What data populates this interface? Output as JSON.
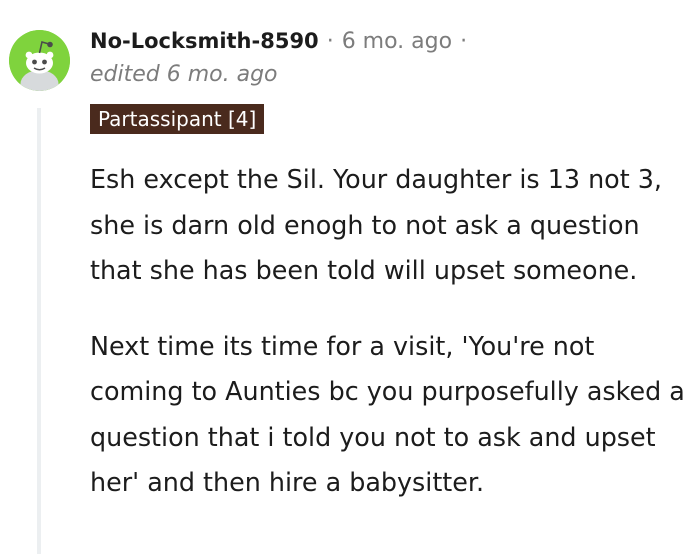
{
  "comment": {
    "username": "No-Locksmith-8590",
    "separator": "·",
    "time_ago": "6 mo. ago",
    "edited": "edited 6 mo. ago",
    "flair": "Partassipant [4]",
    "paragraphs": [
      "Esh except the Sil. Your daughter is 13 not 3, she is darn old enogh to not ask a question that she has been told will upset someone.",
      "Next time its time for a visit, 'You're not coming to Aunties bc you purposefully asked a question that i told you not to ask and upset her' and then hire a babysitter."
    ]
  },
  "colors": {
    "avatar_background": "#7fd33d",
    "flair_background": "#4a2a1d",
    "meta_text": "#7c7c7c",
    "thread_line": "#eceff1"
  },
  "icons": {
    "avatar": "reddit-snoo-avatar-icon"
  }
}
